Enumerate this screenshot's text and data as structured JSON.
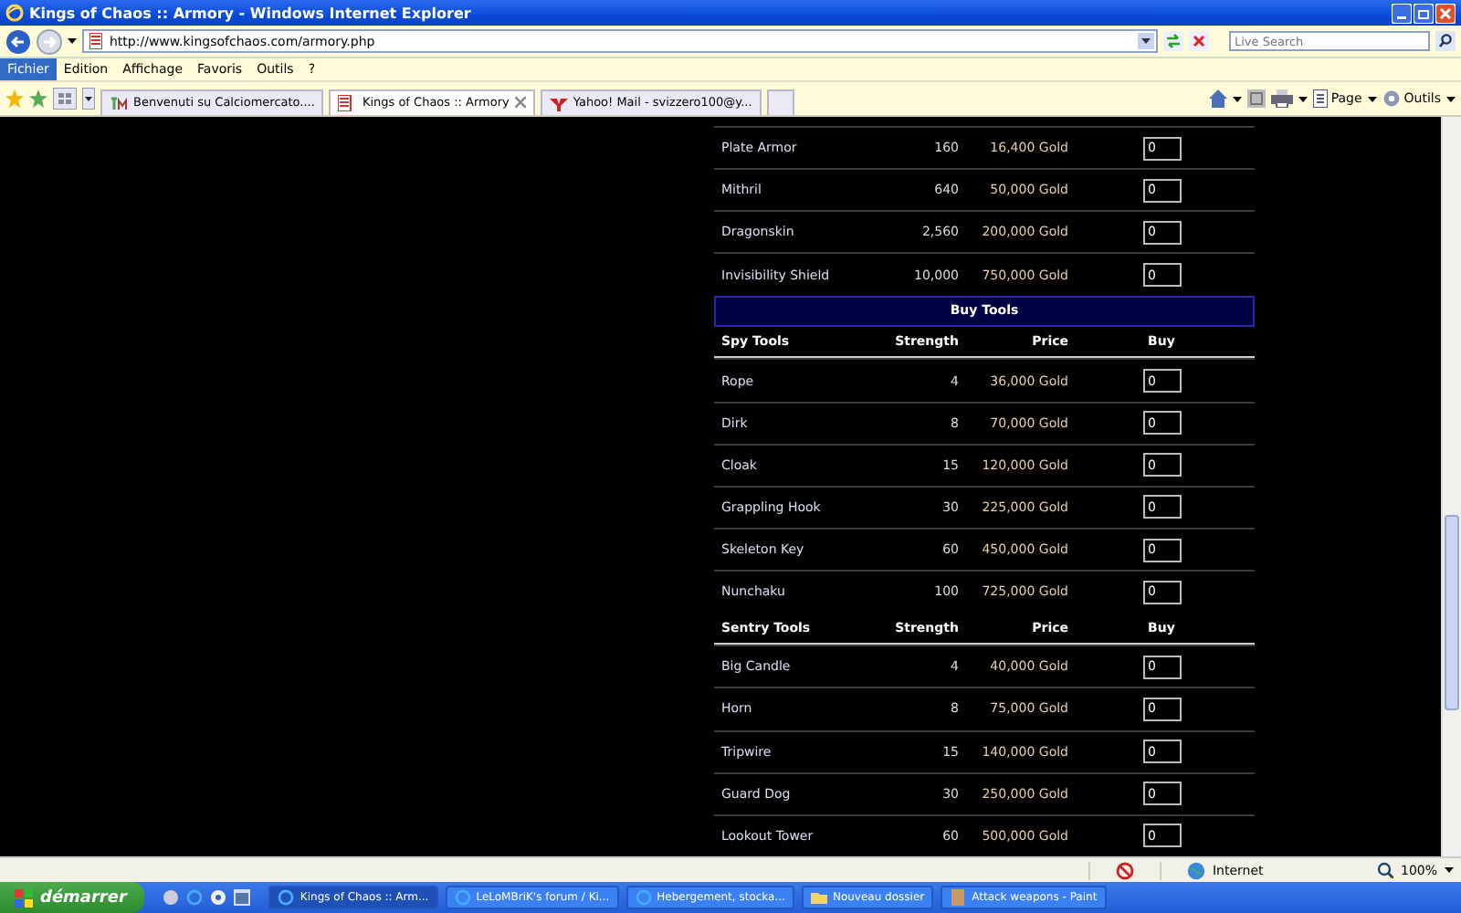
{
  "window": {
    "title": "Kings of Chaos :: Armory - Windows Internet Explorer"
  },
  "address": {
    "url": "http://www.kingsofchaos.com/armory.php"
  },
  "search": {
    "placeholder": "Live Search"
  },
  "menu": [
    {
      "label": "Fichier",
      "selected": true
    },
    {
      "label": "Edition",
      "selected": false
    },
    {
      "label": "Affichage",
      "selected": false
    },
    {
      "label": "Favoris",
      "selected": false
    },
    {
      "label": "Outils",
      "selected": false
    },
    {
      "label": "?",
      "selected": false
    }
  ],
  "tabs": [
    {
      "label": "Benvenuti su Calciomercato....",
      "selected": false
    },
    {
      "label": "Kings of Chaos :: Armory",
      "selected": true
    },
    {
      "label": "Yahoo! Mail - svizzero100@y...",
      "selected": false
    }
  ],
  "toolbar": [
    "Page",
    "Outils"
  ],
  "table": {
    "rows": [
      {
        "kind": "item",
        "name": "Plate Armor",
        "strength": "160",
        "price": "16,400 Gold",
        "buy": "0"
      },
      {
        "kind": "item",
        "name": "Mithril",
        "strength": "640",
        "price": "50,000 Gold",
        "buy": "0"
      },
      {
        "kind": "item",
        "name": "Dragonskin",
        "strength": "2,560",
        "price": "200,000 Gold",
        "buy": "0"
      },
      {
        "kind": "item",
        "name": "Invisibility Shield",
        "strength": "10,000",
        "price": "750,000 Gold",
        "buy": "0"
      },
      {
        "kind": "banner",
        "title": "Buy Tools"
      },
      {
        "kind": "header",
        "cells": [
          "Spy Tools",
          "Strength",
          "Price",
          "Buy"
        ]
      },
      {
        "kind": "item",
        "name": "Rope",
        "strength": "4",
        "price": "36,000 Gold",
        "buy": "0"
      },
      {
        "kind": "item",
        "name": "Dirk",
        "strength": "8",
        "price": "70,000 Gold",
        "buy": "0"
      },
      {
        "kind": "item",
        "name": "Cloak",
        "strength": "15",
        "price": "120,000 Gold",
        "buy": "0"
      },
      {
        "kind": "item",
        "name": "Grappling Hook",
        "strength": "30",
        "price": "225,000 Gold",
        "buy": "0"
      },
      {
        "kind": "item",
        "name": "Skeleton Key",
        "strength": "60",
        "price": "450,000 Gold",
        "buy": "0"
      },
      {
        "kind": "item",
        "name": "Nunchaku",
        "strength": "100",
        "price": "725,000 Gold",
        "buy": "0"
      },
      {
        "kind": "header",
        "cells": [
          "Sentry Tools",
          "Strength",
          "Price",
          "Buy"
        ]
      },
      {
        "kind": "item",
        "name": "Big Candle",
        "strength": "4",
        "price": "40,000 Gold",
        "buy": "0"
      },
      {
        "kind": "item",
        "name": "Horn",
        "strength": "8",
        "price": "75,000 Gold",
        "buy": "0"
      },
      {
        "kind": "item",
        "name": "Tripwire",
        "strength": "15",
        "price": "140,000 Gold",
        "buy": "0"
      },
      {
        "kind": "item",
        "name": "Guard Dog",
        "strength": "30",
        "price": "250,000 Gold",
        "buy": "0"
      },
      {
        "kind": "item",
        "name": "Lookout Tower",
        "strength": "60",
        "price": "500,000 Gold",
        "buy": "0"
      }
    ]
  },
  "status_bar": {
    "zone": "Internet",
    "zoom": "100%"
  },
  "taskbar": {
    "start": "démarrer",
    "tasks": [
      {
        "label": "Kings of Chaos :: Arm...",
        "selected": true
      },
      {
        "label": "LeLoMBriK's forum / Ki...",
        "selected": false
      },
      {
        "label": "Hebergement, stocka...",
        "selected": false
      },
      {
        "label": "Nouveau dossier",
        "selected": false
      },
      {
        "label": "Attack weapons - Paint",
        "selected": false
      }
    ]
  }
}
